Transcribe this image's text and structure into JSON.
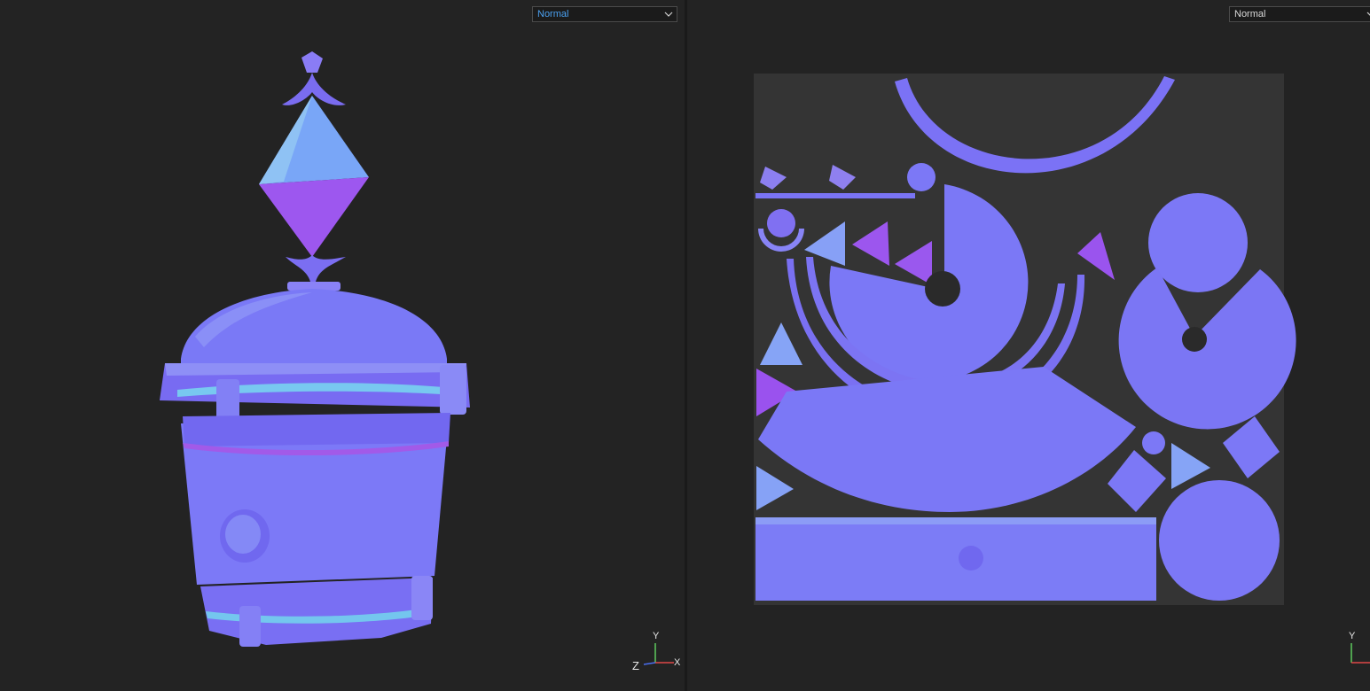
{
  "viewport_3d": {
    "display_mode": "Normal",
    "axis": {
      "y": "Y",
      "z": "Z",
      "x": "X"
    }
  },
  "viewport_uv": {
    "display_mode": "Normal",
    "axis": {
      "y": "Y"
    }
  },
  "colors": {
    "background": "#232323",
    "normal_base": "#7b78f6",
    "normal_light": "#8aa0f5",
    "normal_dark": "#6f4fe8",
    "uv_canvas": "#343434",
    "dropdown_accent": "#4aa0f0"
  }
}
